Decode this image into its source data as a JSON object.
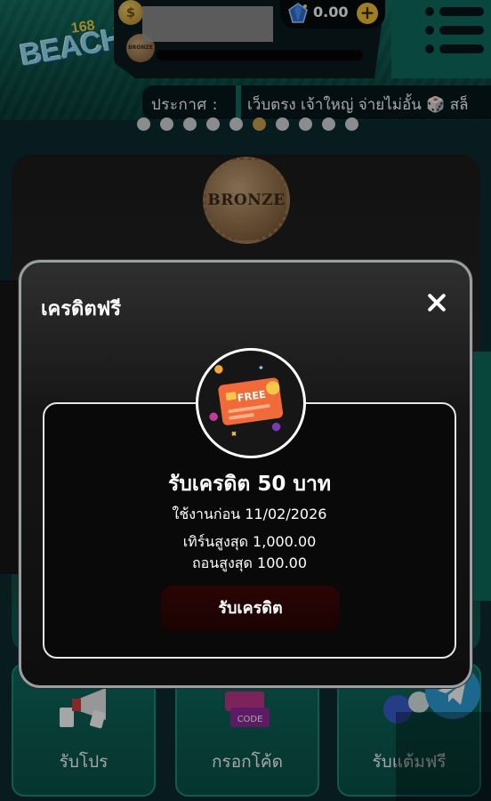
{
  "header": {
    "logo": {
      "number": "168",
      "text": "BEACH"
    },
    "coin_symbol": "$",
    "tier_badge": "BRONZE",
    "credit": {
      "value": "0.00",
      "add_symbol": "+"
    },
    "announcement": {
      "label": "ประกาศ :",
      "text": "เว็บตรง เจ้าใหญ่ จ่ายไม่อั้น 🎲 สล็"
    },
    "carousel": {
      "count": 10,
      "active_index": 5
    }
  },
  "background": {
    "tier_medal": "BRONZE",
    "tiles": [
      {
        "label": "รับโปร",
        "icon": "megaphone-icon"
      },
      {
        "label": "กรอกโค้ด",
        "icon": "code-ticket-icon"
      },
      {
        "label": "รับแต้มฟรี",
        "icon": "points-icon"
      }
    ]
  },
  "modal": {
    "title": "เครดิตฟรี",
    "card": {
      "icon_text": "FREE",
      "title": "รับเครดิต 50 บาท",
      "expiry": "ใช้งานก่อน 11/02/2026",
      "max_turnover": "เทิร์นสูงสุด 1,000.00",
      "max_withdraw": "ถอนสูงสุด 100.00",
      "claim_label": "รับเครดิต"
    }
  },
  "colors": {
    "header_green": "#0f6e60",
    "modal_bg": "#161616",
    "claim_button": "#1a0202",
    "gold_active": "#c9a34a",
    "bronze": "#8a6642"
  }
}
